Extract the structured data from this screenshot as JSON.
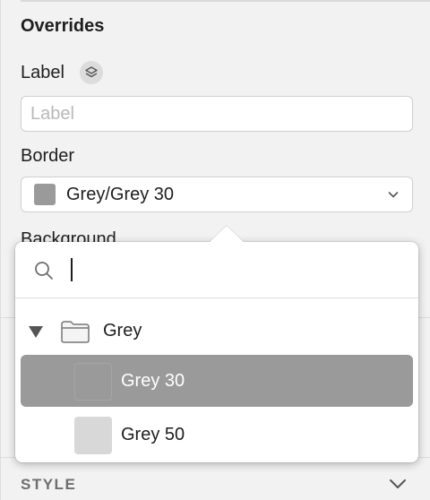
{
  "overrides": {
    "title": "Overrides",
    "label_field": {
      "label": "Label",
      "placeholder": "Label",
      "value": ""
    },
    "border_field": {
      "label": "Border",
      "value": "Grey/Grey 30",
      "swatch_color": "#9a9a9a"
    },
    "background_field": {
      "label": "Background"
    }
  },
  "style_section": {
    "label": "STYLE"
  },
  "color_picker": {
    "search": {
      "placeholder": "",
      "value": ""
    },
    "group": {
      "label": "Grey",
      "expanded": true
    },
    "items": [
      {
        "label": "Grey 30",
        "color": "#9a9a9a",
        "selected": true
      },
      {
        "label": "Grey 50",
        "color": "#d8d8d8",
        "selected": false
      }
    ]
  },
  "colors": {
    "panel_bg": "#f2f2f2",
    "selection_bg": "#9a9a9a"
  }
}
